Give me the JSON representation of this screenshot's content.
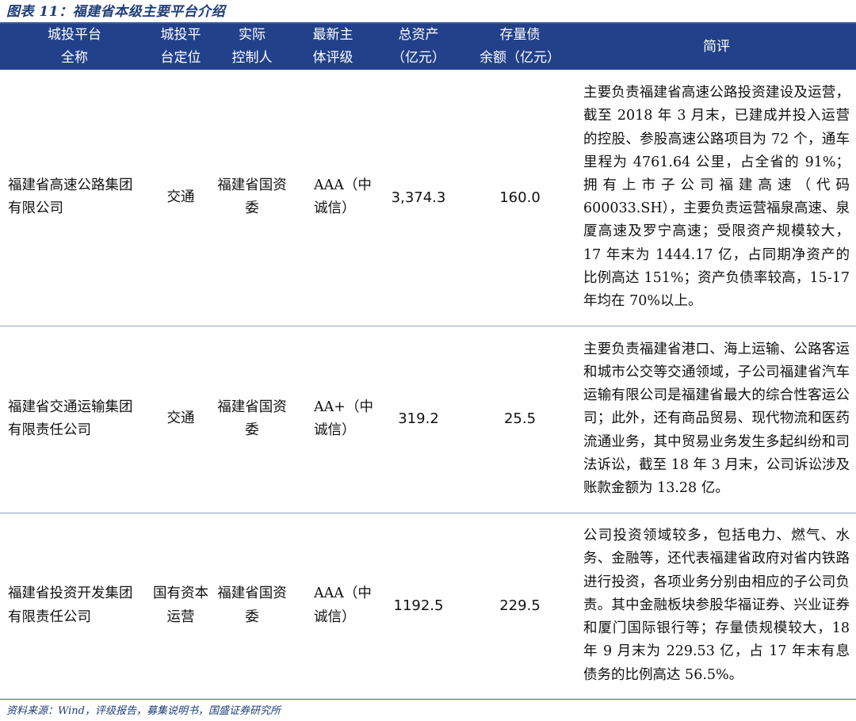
{
  "title": "图表 11：福建省本级主要平台介绍",
  "headers": {
    "name_line1": "城投平台",
    "name_line2": "全称",
    "position_line1": "城投平",
    "position_line2": "台定位",
    "controller_line1": "实际",
    "controller_line2": "控制人",
    "rating_line1": "最新主",
    "rating_line2": "体评级",
    "assets_line1": "总资产",
    "assets_line2": "（亿元）",
    "debt_line1": "存量债",
    "debt_line2": "余额（亿元）",
    "comment": "简评"
  },
  "rows": [
    {
      "name": "福建省高速公路集团有限公司",
      "position": "交通",
      "controller": "福建省国资委",
      "rating": "AAA（中诚信）",
      "assets": "3,374.3",
      "debt": "160.0",
      "comment": "主要负责福建省高速公路投资建设及运营，截至 2018 年 3 月末，已建成并投入运营的控股、参股高速公路项目为 72 个，通车里程为 4761.64 公里，占全省的 91%；拥有上市子公司福建高速（代码 600033.SH），主要负责运营福泉高速、泉厦高速及罗宁高速；受限资产规模较大，17 年末为 1444.17 亿，占同期净资产的比例高达 151%；资产负债率较高，15-17 年均在 70%以上。"
    },
    {
      "name": "福建省交通运输集团有限责任公司",
      "position": "交通",
      "controller": "福建省国资委",
      "rating": "AA+（中诚信）",
      "assets": "319.2",
      "debt": "25.5",
      "comment": "主要负责福建省港口、海上运输、公路客运和城市公交等交通领域，子公司福建省汽车运输有限公司是福建省最大的综合性客运公司；此外，还有商品贸易、现代物流和医药流通业务，其中贸易业务发生多起纠纷和司法诉讼，截至 18 年 3 月末，公司诉讼涉及账款金额为 13.28 亿。"
    },
    {
      "name": "福建省投资开发集团有限责任公司",
      "position": "国有资本运营",
      "controller": "福建省国资委",
      "rating": "AAA（中诚信）",
      "assets": "1192.5",
      "debt": "229.5",
      "comment": "公司投资领域较多，包括电力、燃气、水务、金融等，还代表福建省政府对省内铁路进行投资，各项业务分别由相应的子公司负责。其中金融板块参股华福证券、兴业证券和厦门国际银行等；存量债规模较大，18 年 9 月末为 229.53 亿，占 17 年末有息债务的比例高达 56.5%。"
    }
  ],
  "source": "资料来源：Wind，评级报告，募集说明书，国盛证券研究所"
}
